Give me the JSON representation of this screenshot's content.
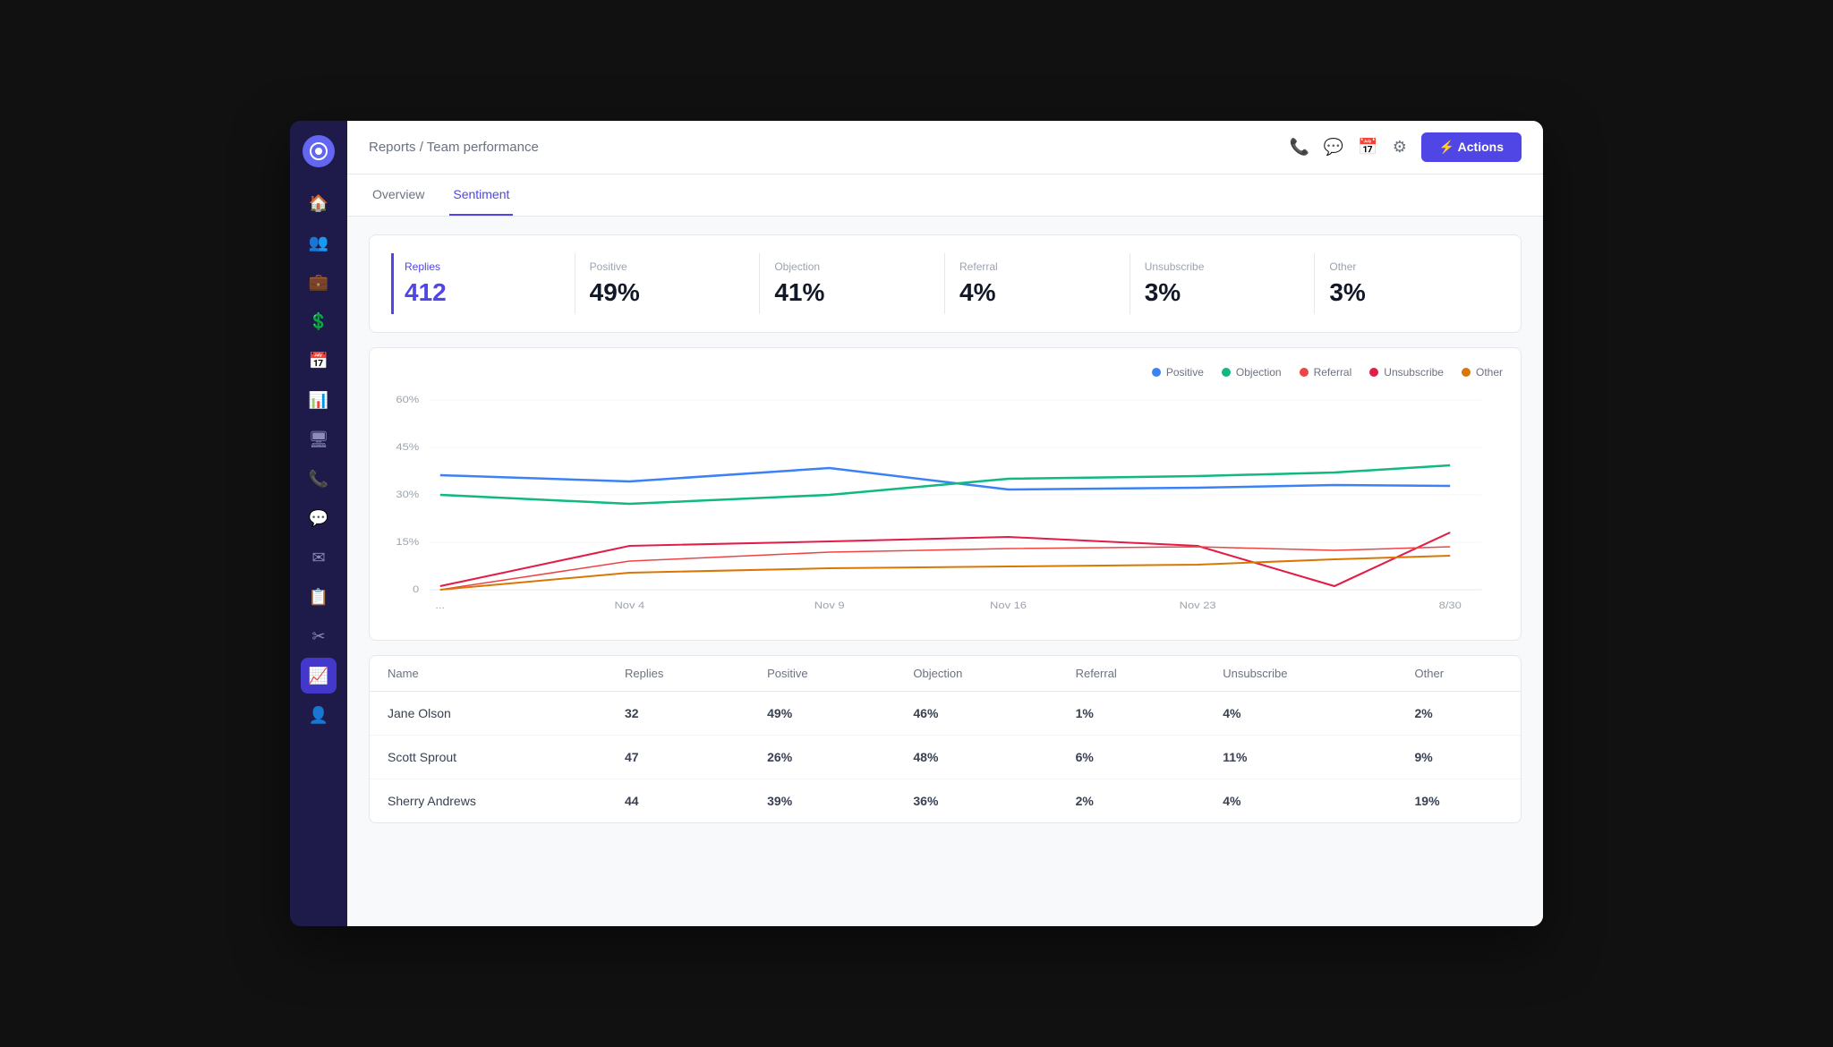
{
  "app": {
    "title": "Reports / Team performance"
  },
  "header": {
    "breadcrumb": "Reports / Team performance",
    "actions_label": "⚡ Actions"
  },
  "tabs": [
    {
      "id": "overview",
      "label": "Overview",
      "active": false
    },
    {
      "id": "sentiment",
      "label": "Sentiment",
      "active": true
    }
  ],
  "stats": [
    {
      "label": "Replies",
      "value": "412",
      "active": true
    },
    {
      "label": "Positive",
      "value": "49%",
      "active": false
    },
    {
      "label": "Objection",
      "value": "41%",
      "active": false
    },
    {
      "label": "Referral",
      "value": "4%",
      "active": false
    },
    {
      "label": "Unsubscribe",
      "value": "3%",
      "active": false
    },
    {
      "label": "Other",
      "value": "3%",
      "active": false
    }
  ],
  "legend": [
    {
      "label": "Positive",
      "color": "#3b82f6"
    },
    {
      "label": "Objection",
      "color": "#10b981"
    },
    {
      "label": "Referral",
      "color": "#ef4444"
    },
    {
      "label": "Unsubscribe",
      "color": "#e11d48"
    },
    {
      "label": "Other",
      "color": "#d97706"
    }
  ],
  "chart": {
    "x_labels": [
      "...",
      "Nov 4",
      "Nov 9",
      "Nov 16",
      "Nov 23",
      "8/30"
    ],
    "y_labels": [
      "60%",
      "45%",
      "30%",
      "15%",
      "0"
    ]
  },
  "table": {
    "headers": [
      "Name",
      "Replies",
      "Positive",
      "Objection",
      "Referral",
      "Unsubscribe",
      "Other"
    ],
    "rows": [
      {
        "name": "Jane Olson",
        "replies": "32",
        "positive": "49%",
        "objection": "46%",
        "referral": "1%",
        "unsubscribe": "4%",
        "other": "2%"
      },
      {
        "name": "Scott Sprout",
        "replies": "47",
        "positive": "26%",
        "objection": "48%",
        "referral": "6%",
        "unsubscribe": "11%",
        "other": "9%"
      },
      {
        "name": "Sherry Andrews",
        "replies": "44",
        "positive": "39%",
        "objection": "36%",
        "referral": "2%",
        "unsubscribe": "4%",
        "other": "19%"
      }
    ]
  },
  "sidebar": {
    "items": [
      {
        "icon": "🏠",
        "name": "home",
        "active": false
      },
      {
        "icon": "👥",
        "name": "contacts",
        "active": false
      },
      {
        "icon": "💼",
        "name": "briefcase",
        "active": false
      },
      {
        "icon": "💲",
        "name": "revenue",
        "active": false
      },
      {
        "icon": "📅",
        "name": "calendar",
        "active": false
      },
      {
        "icon": "📊",
        "name": "reports-alt",
        "active": false
      },
      {
        "icon": "🖥",
        "name": "screen",
        "active": false
      },
      {
        "icon": "📞",
        "name": "phone",
        "active": false
      },
      {
        "icon": "💬",
        "name": "chat",
        "active": false
      },
      {
        "icon": "✉",
        "name": "mail",
        "active": false
      },
      {
        "icon": "📋",
        "name": "clipboard",
        "active": false
      },
      {
        "icon": "✂",
        "name": "tools",
        "active": false
      },
      {
        "icon": "📈",
        "name": "analytics",
        "active": true
      },
      {
        "icon": "👤",
        "name": "profile",
        "active": false
      }
    ]
  }
}
